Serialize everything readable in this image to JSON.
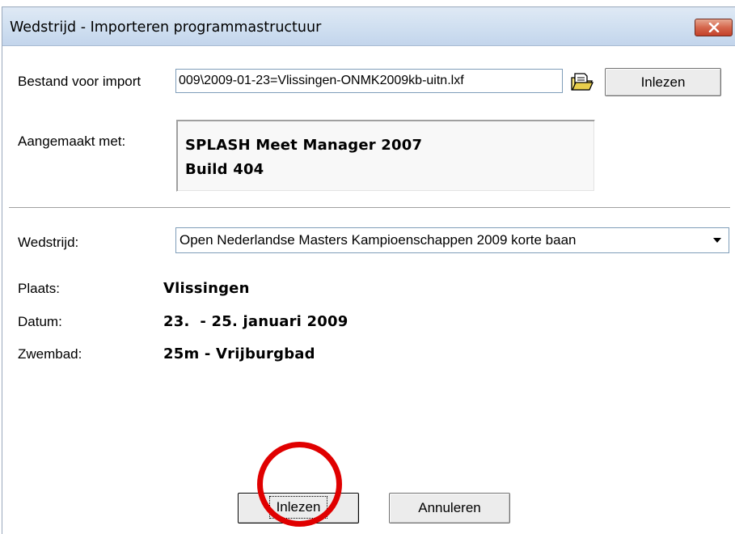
{
  "window": {
    "title": "Wedstrijd - Importeren programmastructuur"
  },
  "file": {
    "label": "Bestand voor import",
    "value": "009\\2009-01-23=Vlissingen-ONMK2009kb-uitn.lxf",
    "read_label": "Inlezen"
  },
  "created": {
    "label": "Aangemaakt met:",
    "line1": "SPLASH Meet Manager 2007",
    "line2": "Build 404"
  },
  "meet": {
    "label": "Wedstrijd:",
    "selected": "Open Nederlandse Masters Kampioenschappen 2009 korte baan",
    "place_label": "Plaats:",
    "place": "Vlissingen",
    "date_label": "Datum:",
    "date": "23.  - 25. januari 2009",
    "pool_label": "Zwembad:",
    "pool": "25m - Vrijburgbad"
  },
  "buttons": {
    "ok_label": "Inlezen",
    "cancel_label": "Annuleren"
  },
  "colors": {
    "highlight_circle": "#e00000"
  }
}
